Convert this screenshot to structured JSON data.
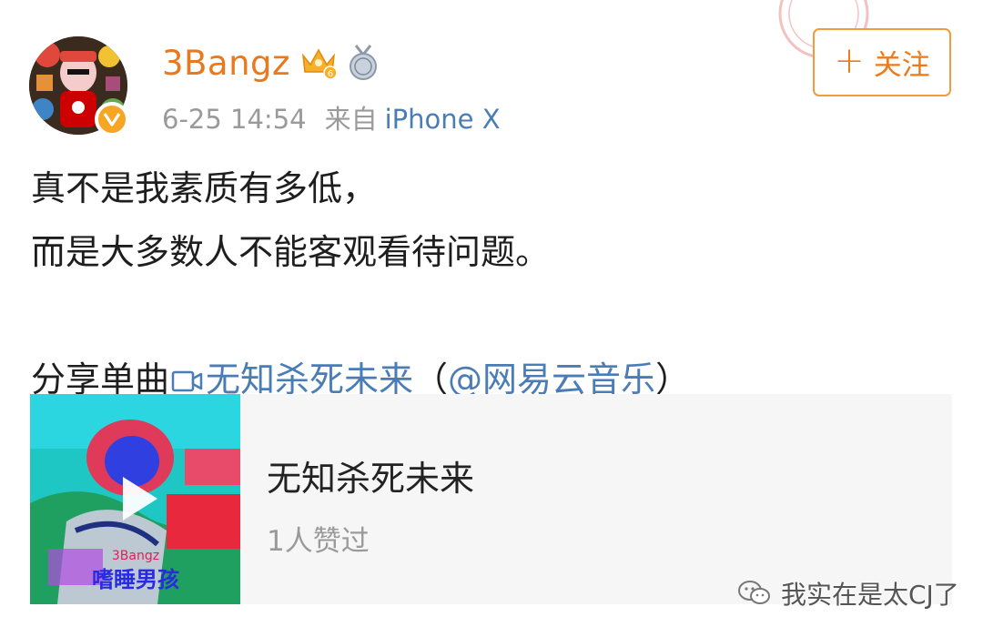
{
  "user": {
    "name": "3Bangz",
    "badges": [
      "crown-level-6-icon",
      "medal-icon"
    ],
    "verified_icon": "verified-v-badge-icon",
    "timestamp": "6-25 14:54",
    "source_label": "来自",
    "device": "iPhone X"
  },
  "follow_button": {
    "icon": "plus-icon",
    "label": "关注"
  },
  "post": {
    "line1": "真不是我素质有多低，",
    "line2": "而是大多数人不能客观看待问题。",
    "share_prefix": "分享单曲",
    "song_link": "无知杀死未来",
    "paren_open": "（",
    "mention": "@网易云音乐",
    "paren_close": "）"
  },
  "music_card": {
    "title": "无知杀死未来",
    "likes": "1人赞过",
    "play_icon": "play-icon",
    "cover_text_artist": "3Bangz",
    "cover_text_album": "嗜睡男孩"
  },
  "watermark": {
    "icon": "wechat-icon",
    "text": "我实在是太CJ了"
  },
  "colors": {
    "username": "#e8791f",
    "follow": "#ec7a1a",
    "link": "#4a7db5",
    "meta": "#9a9a9a",
    "verified": "#f6a623"
  }
}
